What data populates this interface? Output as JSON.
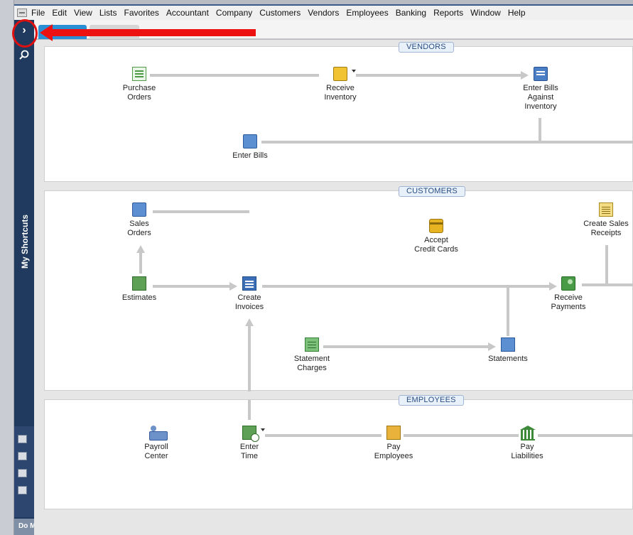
{
  "menu": {
    "items": [
      "File",
      "Edit",
      "View",
      "Lists",
      "Favorites",
      "Accountant",
      "Company",
      "Customers",
      "Vendors",
      "Employees",
      "Banking",
      "Reports",
      "Window",
      "Help"
    ]
  },
  "sidebar": {
    "toggle_glyph": "›",
    "section_label": "My Shortcuts",
    "footer_text": "Do M"
  },
  "sections": {
    "vendors": "VENDORS",
    "customers": "CUSTOMERS",
    "employees": "EMPLOYEES"
  },
  "nodes": {
    "purchase_orders": "Purchase\nOrders",
    "receive_inventory": "Receive\nInventory",
    "enter_bills_against_inventory": "Enter Bills\nAgainst\nInventory",
    "enter_bills": "Enter Bills",
    "sales_orders": "Sales\nOrders",
    "accept_credit_cards": "Accept\nCredit Cards",
    "create_sales_receipts": "Create Sales\nReceipts",
    "estimates": "Estimates",
    "create_invoices": "Create\nInvoices",
    "receive_payments": "Receive\nPayments",
    "statement_charges": "Statement\nCharges",
    "statements": "Statements",
    "payroll_center": "Payroll\nCenter",
    "enter_time": "Enter\nTime",
    "pay_employees": "Pay\nEmployees",
    "pay_liabilities": "Pay\nLiabilities"
  },
  "icons": {
    "purchase_orders": "purchase-order-icon",
    "receive_inventory": "receive-inventory-icon",
    "enter_bills_against_inventory": "bill-against-inventory-icon",
    "enter_bills": "enter-bills-icon",
    "sales_orders": "sales-order-icon",
    "accept_credit_cards": "credit-card-icon",
    "create_sales_receipts": "sales-receipt-icon",
    "estimates": "estimate-icon",
    "create_invoices": "invoice-icon",
    "receive_payments": "payment-icon",
    "statement_charges": "statement-charges-icon",
    "statements": "statements-icon",
    "payroll_center": "payroll-center-icon",
    "enter_time": "timesheet-icon",
    "pay_employees": "paycheck-icon",
    "pay_liabilities": "bank-icon"
  },
  "colors": {
    "sidebar_bg": "#1f3a5e",
    "active_tab": "#2b8fd6",
    "annotation_red": "#ee1111",
    "section_label_text": "#2a4d80",
    "flow_line": "#c8c8c8"
  }
}
